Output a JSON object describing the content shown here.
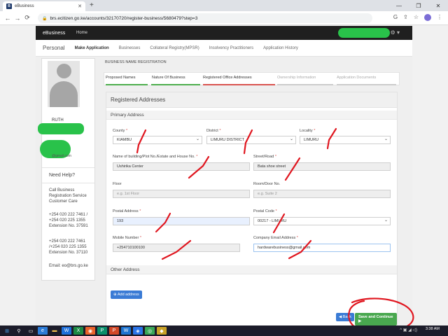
{
  "browser": {
    "tab_title": "eBusiness",
    "tab_icon_letter": "B",
    "new_tab": "+",
    "url": "brs.ecitizen.go.ke/accounts/32170720/register-business/5680479?step=3"
  },
  "appbar": {
    "brand": "eBusiness",
    "home": "Home"
  },
  "subnav": {
    "title": "Personal",
    "items": [
      "Make Application",
      "Businesses",
      "Collateral Registry(MPSR)",
      "Insolvency Practitioners",
      "Application History"
    ]
  },
  "sidebar": {
    "username": "RUTH",
    "email": "@gmail.com",
    "need_help": "Need Help?",
    "service_lines": [
      "Call Business",
      "Registration Service",
      "Customer Care"
    ],
    "phone_block_1": [
      "+254 020 222 7461 /",
      "+254 020 225 1355",
      "Extension No. 37591"
    ],
    "phone_block_2": [
      "+254 020 222 7461",
      "/+254 020 225 1355",
      "Extension No. 37110"
    ],
    "email_line": "Email: eo@brs.go.ke"
  },
  "page": {
    "heading": "BUSINESS NAME REGISTRATION",
    "steps": [
      {
        "label": "Proposed Names",
        "status": "done"
      },
      {
        "label": "Nature Of Business",
        "status": "done"
      },
      {
        "label": "Registered Office Addresses",
        "status": "current"
      },
      {
        "label": "Ownership Information",
        "status": "pending"
      },
      {
        "label": "Application Documents",
        "status": "pending"
      }
    ],
    "colors": {
      "done": "#4cae4c",
      "current": "#d9534f",
      "pending": "#cccccc"
    }
  },
  "form": {
    "title": "Registered Addresses",
    "primary_title": "Primary Address",
    "county_label": "County",
    "county_value": "KIAMBU",
    "district_label": "District",
    "district_value": "LIMURU DISTRICT",
    "locality_label": "Locality",
    "locality_value": "LIMURU",
    "building_label": "Name of building/Plot No./Estate and House No.",
    "building_value": "Ushirika Center",
    "street_label": "Street/Road",
    "street_value": "Bata shoe street",
    "floor_label": "Floor",
    "floor_placeholder": "e.g. 1st Floor",
    "room_label": "Room/Door No.",
    "room_placeholder": "e.g. Suite 2",
    "postal_address_label": "Postal Address",
    "postal_address_value": "193",
    "postal_code_label": "Postal Code",
    "postal_code_value": "00217 - LIMURU",
    "mobile_label": "Mobile Number",
    "mobile_value": "+254710100100",
    "company_email_label": "Company Email Address",
    "company_email_value": "hardwarebusiness@gmail.com",
    "required_mark": "*",
    "other_title": "Other Address",
    "add_button": "Add address",
    "back_button": "Back",
    "save_button": "Save and Continue"
  },
  "taskbar": {
    "time": "3:38 AM"
  },
  "icons": [
    "back-arrow-icon",
    "forward-arrow-icon",
    "reload-icon",
    "lock-icon",
    "share-icon",
    "star-icon",
    "gear-icon",
    "windows-start-icon",
    "search-icon",
    "plus-icon",
    "chevron-down-icon"
  ]
}
